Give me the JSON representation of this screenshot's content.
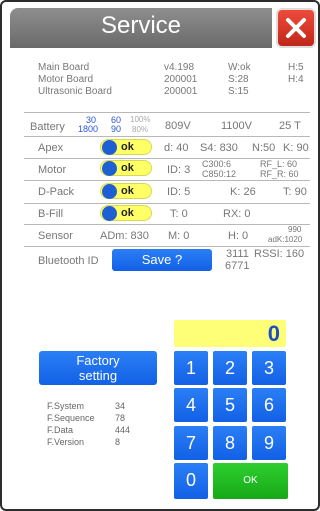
{
  "header": {
    "title": "Service"
  },
  "info": [
    {
      "label": "Main Board",
      "v1": "v4.198",
      "v2": "W:ok",
      "v3": "H:5"
    },
    {
      "label": "Motor Board",
      "v1": "200001",
      "v2": "S:28",
      "v3": "H:4"
    },
    {
      "label": "Ultrasonic Board",
      "v1": "200001",
      "v2": "S:15",
      "v3": ""
    }
  ],
  "battery": {
    "label": "Battery",
    "a_top": "30",
    "a_bot": "1800",
    "b_top": "60",
    "b_bot": "90",
    "c_top": "100%",
    "c_bot": "80%",
    "v1": "809V",
    "v2": "1100V",
    "v3": "25 T"
  },
  "apex": {
    "label": "Apex",
    "toggle": "ok",
    "d": "d: 40",
    "s4": "S4: 830",
    "n": "N:50",
    "k": "K: 90"
  },
  "motor": {
    "label": "Motor",
    "toggle": "ok",
    "id": "ID: 3",
    "c300": "C300:6",
    "c850": "C850:12",
    "rfl": "RF_L: 60",
    "rfr": "RF_R: 60"
  },
  "dpack": {
    "label": "D-Pack",
    "toggle": "ok",
    "id": "ID: 5",
    "k": "K: 26",
    "t": "T: 90"
  },
  "bfill": {
    "label": "B-Fill",
    "toggle": "ok",
    "t": "T: 0",
    "rx": "RX: 0"
  },
  "sensor": {
    "label": "Sensor",
    "adm": "ADm: 830",
    "m": "M: 0",
    "h": "H: 0",
    "adk_top": "990",
    "adk_bot": "adK:1020"
  },
  "bluetooth": {
    "label": "Bluetooth ID",
    "save": "Save ?",
    "id1": "3111",
    "id2": "6771",
    "rssi": "RSSI: 160"
  },
  "factory": {
    "label_line1": "Factory",
    "label_line2": "setting"
  },
  "fsys": [
    {
      "label": "F.System",
      "value": "34"
    },
    {
      "label": "F.Sequence",
      "value": "78"
    },
    {
      "label": "F.Data",
      "value": "444"
    },
    {
      "label": "F.Version",
      "value": "8"
    }
  ],
  "keypad": {
    "display": "0",
    "keys": [
      "1",
      "2",
      "3",
      "4",
      "5",
      "6",
      "7",
      "8",
      "9",
      "0"
    ],
    "ok": "OK"
  },
  "colors": {
    "accent_blue": "#1260e6",
    "toggle_yellow": "#ffff66",
    "ok_green": "#17a817",
    "close_red": "#d22f22"
  }
}
